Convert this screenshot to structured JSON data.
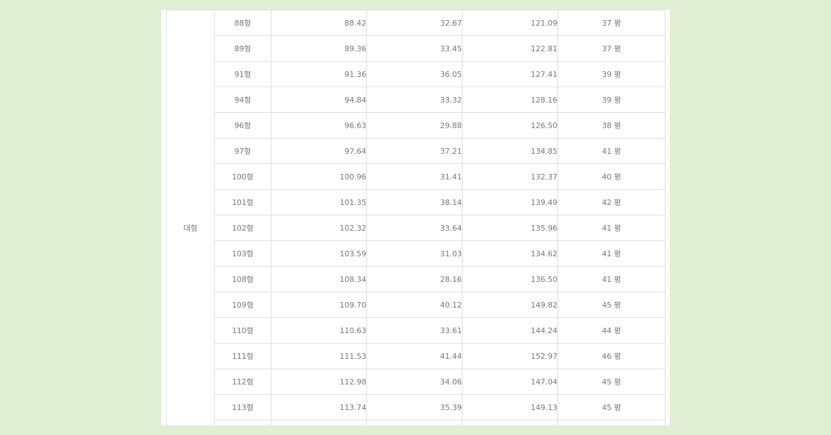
{
  "table": {
    "category": "대형",
    "rows": [
      {
        "type": "88형",
        "exclusive": "88.42",
        "shared": "32.67",
        "supply": "121.09",
        "pyeong": "37 평"
      },
      {
        "type": "89형",
        "exclusive": "89.36",
        "shared": "33.45",
        "supply": "122.81",
        "pyeong": "37 평"
      },
      {
        "type": "91형",
        "exclusive": "91.36",
        "shared": "36.05",
        "supply": "127.41",
        "pyeong": "39 평"
      },
      {
        "type": "94형",
        "exclusive": "94.84",
        "shared": "33.32",
        "supply": "128.16",
        "pyeong": "39 평"
      },
      {
        "type": "96형",
        "exclusive": "96.63",
        "shared": "29.88",
        "supply": "126.50",
        "pyeong": "38 평"
      },
      {
        "type": "97형",
        "exclusive": "97.64",
        "shared": "37.21",
        "supply": "134.85",
        "pyeong": "41 평"
      },
      {
        "type": "100형",
        "exclusive": "100.96",
        "shared": "31.41",
        "supply": "132.37",
        "pyeong": "40 평"
      },
      {
        "type": "101형",
        "exclusive": "101.35",
        "shared": "38.14",
        "supply": "139.49",
        "pyeong": "42 평"
      },
      {
        "type": "102형",
        "exclusive": "102.32",
        "shared": "33.64",
        "supply": "135.96",
        "pyeong": "41 평"
      },
      {
        "type": "103형",
        "exclusive": "103.59",
        "shared": "31.03",
        "supply": "134.62",
        "pyeong": "41 평"
      },
      {
        "type": "108형",
        "exclusive": "108.34",
        "shared": "28.16",
        "supply": "136.50",
        "pyeong": "41 평"
      },
      {
        "type": "109형",
        "exclusive": "109.70",
        "shared": "40.12",
        "supply": "149.82",
        "pyeong": "45 평"
      },
      {
        "type": "110형",
        "exclusive": "110.63",
        "shared": "33.61",
        "supply": "144.24",
        "pyeong": "44 평"
      },
      {
        "type": "111형",
        "exclusive": "111.53",
        "shared": "41.44",
        "supply": "152.97",
        "pyeong": "46 평"
      },
      {
        "type": "112형",
        "exclusive": "112.98",
        "shared": "34.06",
        "supply": "147.04",
        "pyeong": "45 평"
      },
      {
        "type": "113형",
        "exclusive": "113.74",
        "shared": "35.39",
        "supply": "149.13",
        "pyeong": "45 평"
      },
      {
        "type": "",
        "exclusive": "",
        "shared": "",
        "supply": "",
        "pyeong": ""
      }
    ]
  }
}
